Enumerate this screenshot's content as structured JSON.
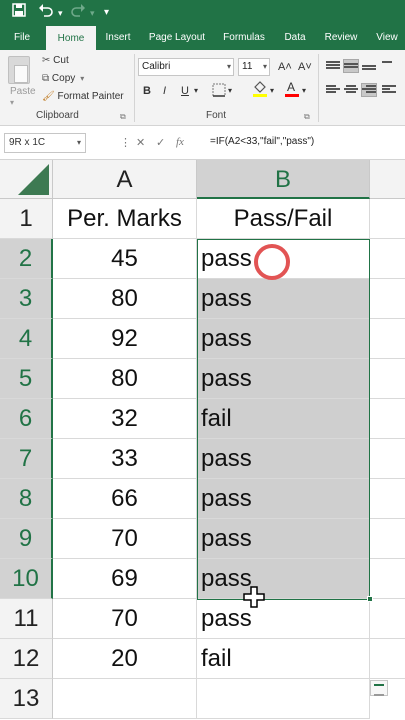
{
  "qat": {
    "save_icon": "save-icon",
    "undo_icon": "undo-icon",
    "redo_icon": "redo-icon"
  },
  "tabs": [
    "File",
    "Home",
    "Insert",
    "Page Layout",
    "Formulas",
    "Data",
    "Review",
    "View"
  ],
  "active_tab": "Home",
  "clipboard": {
    "paste": "Paste",
    "cut": "Cut",
    "copy": "Copy",
    "format_painter": "Format Painter",
    "group_label": "Clipboard"
  },
  "font": {
    "name": "Calibri",
    "size": "11",
    "bold": "B",
    "italic": "I",
    "underline": "U",
    "grow": "A˄",
    "shrink": "A˅",
    "group_label": "Font",
    "fill_color": "#ffff00",
    "font_color": "#ff0000"
  },
  "formula_bar": {
    "name_box": "9R x 1C",
    "formula": "=IF(A2<33,\"fail\",\"pass\")",
    "fx": "fx"
  },
  "sheet": {
    "columns": [
      "A",
      "B"
    ],
    "rows": [
      "1",
      "2",
      "3",
      "4",
      "5",
      "6",
      "7",
      "8",
      "9",
      "10",
      "11",
      "12",
      "13"
    ],
    "header_a": "Per. Marks",
    "header_b": "Pass/Fail",
    "marks": [
      "45",
      "80",
      "92",
      "80",
      "32",
      "33",
      "66",
      "70",
      "69",
      "70",
      "20"
    ],
    "results": [
      "pass",
      "pass",
      "pass",
      "pass",
      "fail",
      "pass",
      "pass",
      "pass",
      "pass",
      "pass",
      "fail"
    ],
    "selected_range": "B2:B10",
    "accent": "#217346"
  }
}
